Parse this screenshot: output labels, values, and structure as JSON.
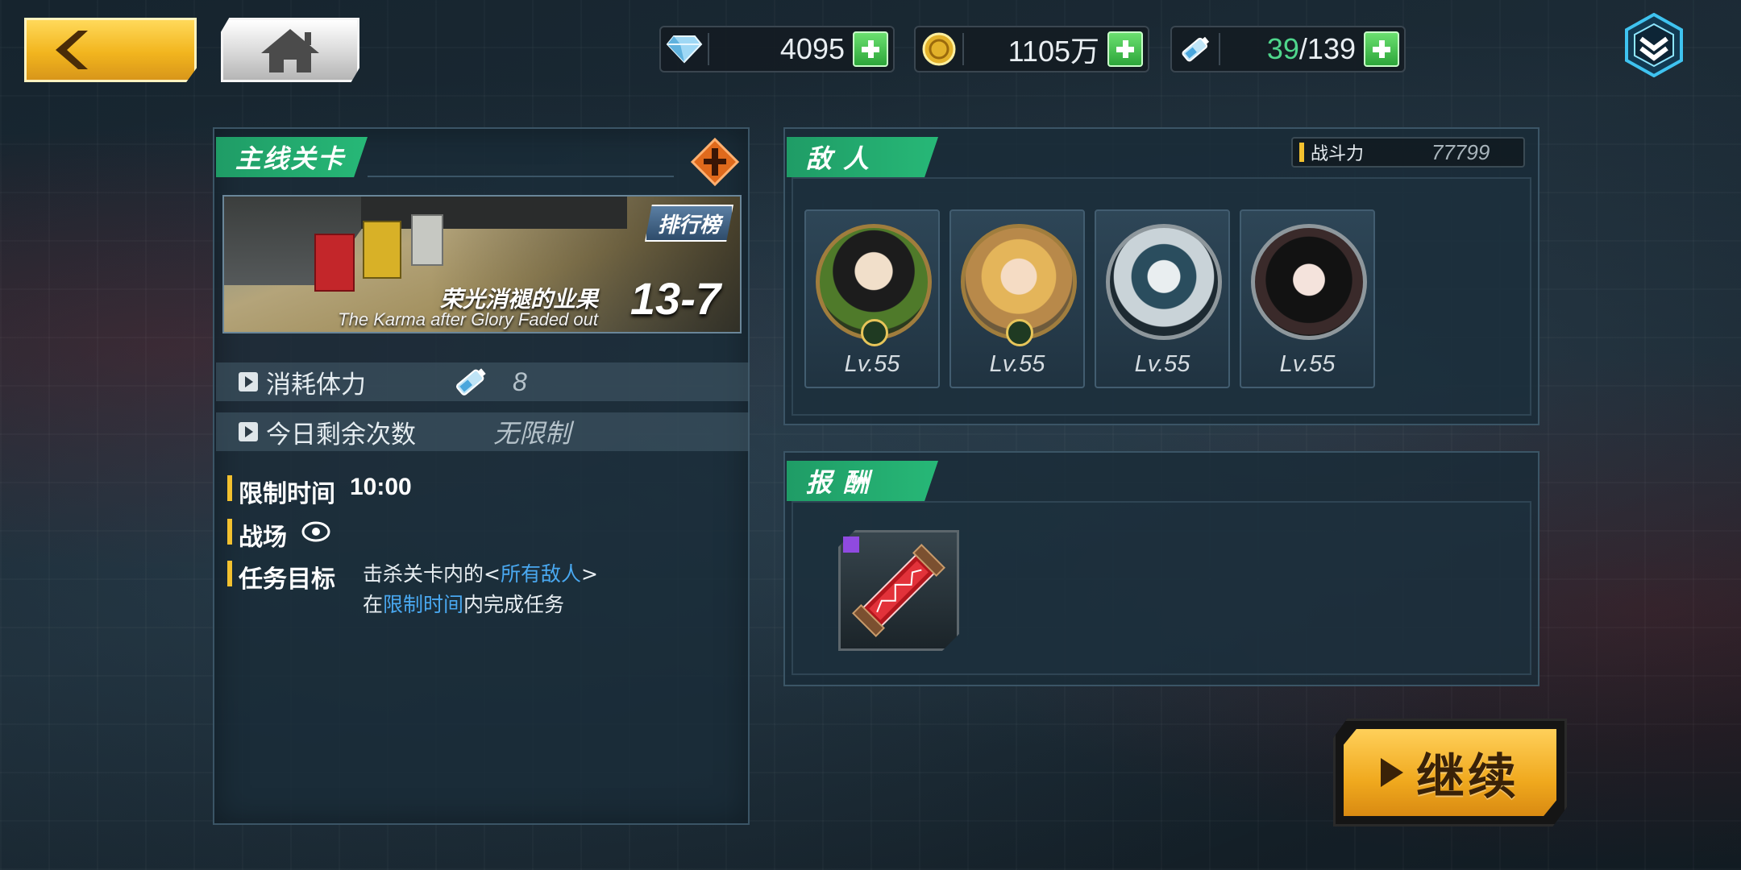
{
  "topbar": {
    "diamonds": "4095",
    "gold": "1105万",
    "stamina_current": "39",
    "stamina_separator": "/139"
  },
  "stage": {
    "section_label": "主线关卡",
    "ranking_label": "排行榜",
    "name_cn": "荣光消褪的业果",
    "name_en": "The Karma after Glory Faded out",
    "number": "13-7",
    "stamina_cost_label": "消耗体力",
    "stamina_cost_value": "8",
    "daily_left_label": "今日剩余次数",
    "daily_left_value": "无限制",
    "time_limit_label": "限制时间",
    "time_limit_value": "10:00",
    "battlefield_label": "战场",
    "objective_label": "任务目标",
    "objective_line1_pre": "击杀关卡内的<",
    "objective_line1_hl": "所有敌人",
    "objective_line1_post": ">",
    "objective_line2_pre": "在",
    "objective_line2_hl": "限制时间",
    "objective_line2_post": "内完成任务"
  },
  "enemies": {
    "section_label": "敌人",
    "power_label": "战斗力",
    "power_value": "77799",
    "list": [
      {
        "level": "Lv.55"
      },
      {
        "level": "Lv.55"
      },
      {
        "level": "Lv.55"
      },
      {
        "level": "Lv.55"
      }
    ]
  },
  "rewards": {
    "section_label": "报酬"
  },
  "continue_label": "继续",
  "colors": {
    "accent_green": "#27b877",
    "accent_gold": "#f3c12f",
    "highlight_blue": "#49a8f0",
    "stamina_green": "#4fd68c"
  }
}
